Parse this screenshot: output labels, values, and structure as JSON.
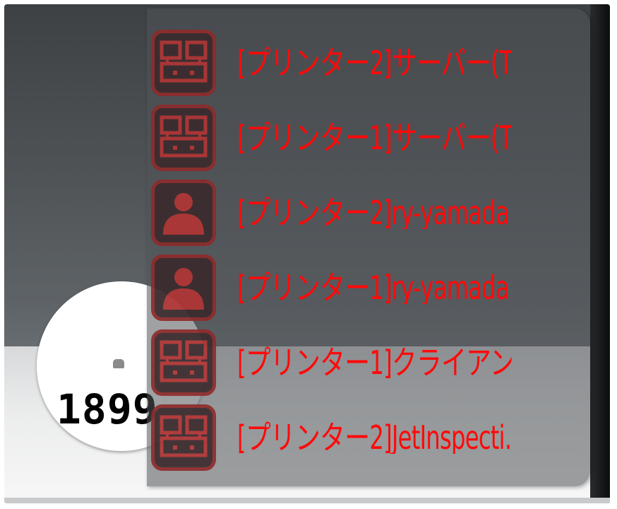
{
  "gauge": {
    "value": "1899"
  },
  "notifications": [
    {
      "icon": "network-device-icon",
      "text": "[プリンター2]サーバー(T..."
    },
    {
      "icon": "network-device-icon",
      "text": "[プリンター1]サーバー(T..."
    },
    {
      "icon": "user-icon",
      "text": "[プリンター2]ry-yamada..."
    },
    {
      "icon": "user-icon",
      "text": "[プリンター1]ry-yamada..."
    },
    {
      "icon": "network-device-icon",
      "text": "[プリンター1]クライアント..."
    },
    {
      "icon": "network-device-icon",
      "text": "[プリンター2]JetInspecti..."
    }
  ],
  "colors": {
    "text": "#ff0a0a",
    "icon": "#b33434",
    "icon_border": "#8f2a2a"
  }
}
